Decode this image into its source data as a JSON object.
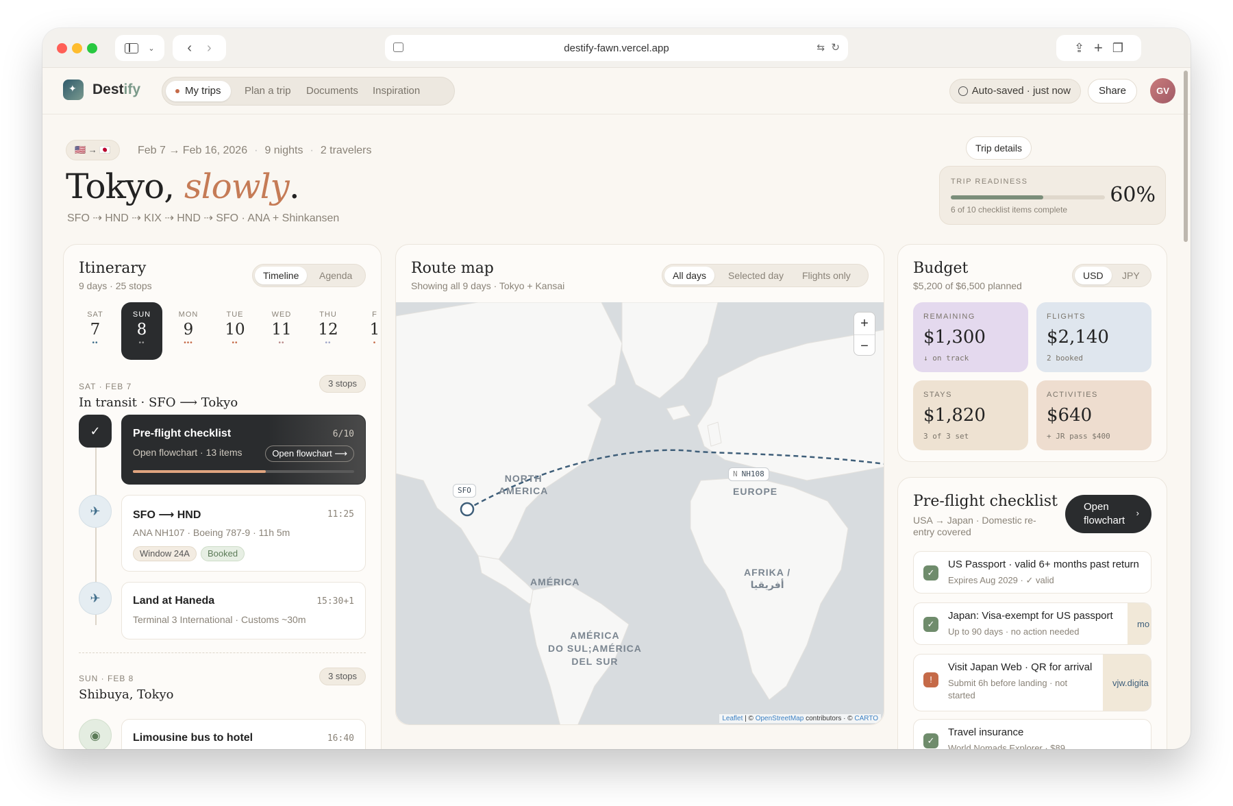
{
  "browser": {
    "url": "destify-fawn.vercel.app"
  },
  "app": {
    "brand_main": "Dest",
    "brand_accent": "ify",
    "nav": [
      "My trips",
      "Plan a trip",
      "Documents",
      "Inspiration"
    ],
    "autosave": "Auto-saved · just now",
    "share": "Share",
    "avatar": "GV"
  },
  "trip": {
    "flags": "🇺🇸 → 🇯🇵",
    "dates": "Feb 7 → Feb 16, 2026",
    "nights": "9 nights",
    "travelers": "2 travelers",
    "title_main": "Tokyo, ",
    "title_accent": "slowly",
    "title_end": ".",
    "route": "SFO ⇢ HND ⇢ KIX ⇢ HND ⇢ SFO · ANA + Shinkansen",
    "details_button": "Trip details",
    "readiness_label": "TRIP READINESS",
    "readiness_sub": "6 of 10 checklist items complete",
    "readiness_pct": "60%",
    "readiness_fraction": 0.6
  },
  "itinerary": {
    "title": "Itinerary",
    "sub": "9 days · 25 stops",
    "views": [
      "Timeline",
      "Agenda"
    ],
    "days": [
      {
        "dow": "SAT",
        "num": "7",
        "dots": "••",
        "dotcolor": "#3f6d8a"
      },
      {
        "dow": "SUN",
        "num": "8",
        "dots": "••",
        "dotcolor": "#999999"
      },
      {
        "dow": "MON",
        "num": "9",
        "dots": "•••",
        "dotcolor": "#c56a48"
      },
      {
        "dow": "TUE",
        "num": "10",
        "dots": "••",
        "dotcolor": "#c56a48"
      },
      {
        "dow": "WED",
        "num": "11",
        "dots": "••",
        "dotcolor": "#b98a8a"
      },
      {
        "dow": "THU",
        "num": "12",
        "dots": "••",
        "dotcolor": "#a0a6c8"
      },
      {
        "dow": "F",
        "num": "1",
        "dots": "•",
        "dotcolor": "#c56a48"
      }
    ],
    "sec1_head": "SAT · FEB 7",
    "sec1_title": "In transit · SFO ⟶ Tokyo",
    "sec1_stops": "3 stops",
    "checklist_title": "Pre-flight checklist",
    "checklist_count": "6/10",
    "checklist_sub": "Open flowchart · 13 items",
    "checklist_btn": "Open flowchart ⟶",
    "checklist_progress": 0.6,
    "flight_title": "SFO ⟶ HND",
    "flight_time": "11:25",
    "flight_sub": "ANA NH107 · Boeing 787-9 · 11h 5m",
    "flight_chip1": "Window 24A",
    "flight_chip2": "Booked",
    "land_title": "Land at Haneda",
    "land_time": "15:30+1",
    "land_sub": "Terminal 3 International · Customs ~30m",
    "sec2_head": "SUN · FEB 8",
    "sec2_title": "Shibuya, Tokyo",
    "sec2_stops": "3 stops",
    "bus_title": "Limousine bus to hotel",
    "bus_time": "16:40"
  },
  "map": {
    "title": "Route map",
    "sub": "Showing all 9 days · Tokyo + Kansai",
    "filters": [
      "All days",
      "Selected day",
      "Flights only"
    ],
    "zoom_in": "+",
    "zoom_out": "−",
    "labels": {
      "na": "NORTH\nAMERICA",
      "eu": "EUROPE",
      "af": "AFRIKA /\nأفريقيا",
      "am": "AMÉRICA",
      "sa": "AMÉRICA\nDO SUL;AMÉRICA\nDEL SUR"
    },
    "pin_sfo": "SFO",
    "pin_flight": "NH108",
    "pin_flight_prefix": "N",
    "attr_leaflet": "Leaflet",
    "attr_mid": " | © ",
    "attr_osm": "OpenStreetMap",
    "attr_end": " contributors · © ",
    "attr_carto": "CARTO"
  },
  "budget": {
    "title": "Budget",
    "sub": "$5,200 of $6,500 planned",
    "currencies": [
      "USD",
      "JPY"
    ],
    "tiles": [
      {
        "label": "REMAINING",
        "value": "$1,300",
        "note": "↓ on track",
        "color": "#e4d9ee"
      },
      {
        "label": "FLIGHTS",
        "value": "$2,140",
        "note": "2 booked",
        "color": "#dfe6ee"
      },
      {
        "label": "STAYS",
        "value": "$1,820",
        "note": "3 of 3 set",
        "color": "#eee2d2"
      },
      {
        "label": "ACTIVITIES",
        "value": "$640",
        "note": "+ JR pass $400",
        "color": "#eeddcf"
      }
    ]
  },
  "checklist": {
    "title": "Pre-flight checklist",
    "sub": "USA → Japan · Domestic re-entry covered",
    "button": "Open flowchart",
    "items": [
      {
        "title": "US Passport · valid 6+ months past return",
        "sub": "Expires Aug 2029 · ✓ valid",
        "side": ""
      },
      {
        "title": "Japan: Visa-exempt for US passport",
        "sub": "Up to 90 days · no action needed",
        "side": "mo"
      },
      {
        "title": "Visit Japan Web · QR for arrival",
        "sub": "Submit 6h before landing · not started",
        "side": "vjw.digita"
      },
      {
        "title": "Travel insurance",
        "sub": "World Nomads Explorer · $89",
        "side": ""
      }
    ]
  }
}
